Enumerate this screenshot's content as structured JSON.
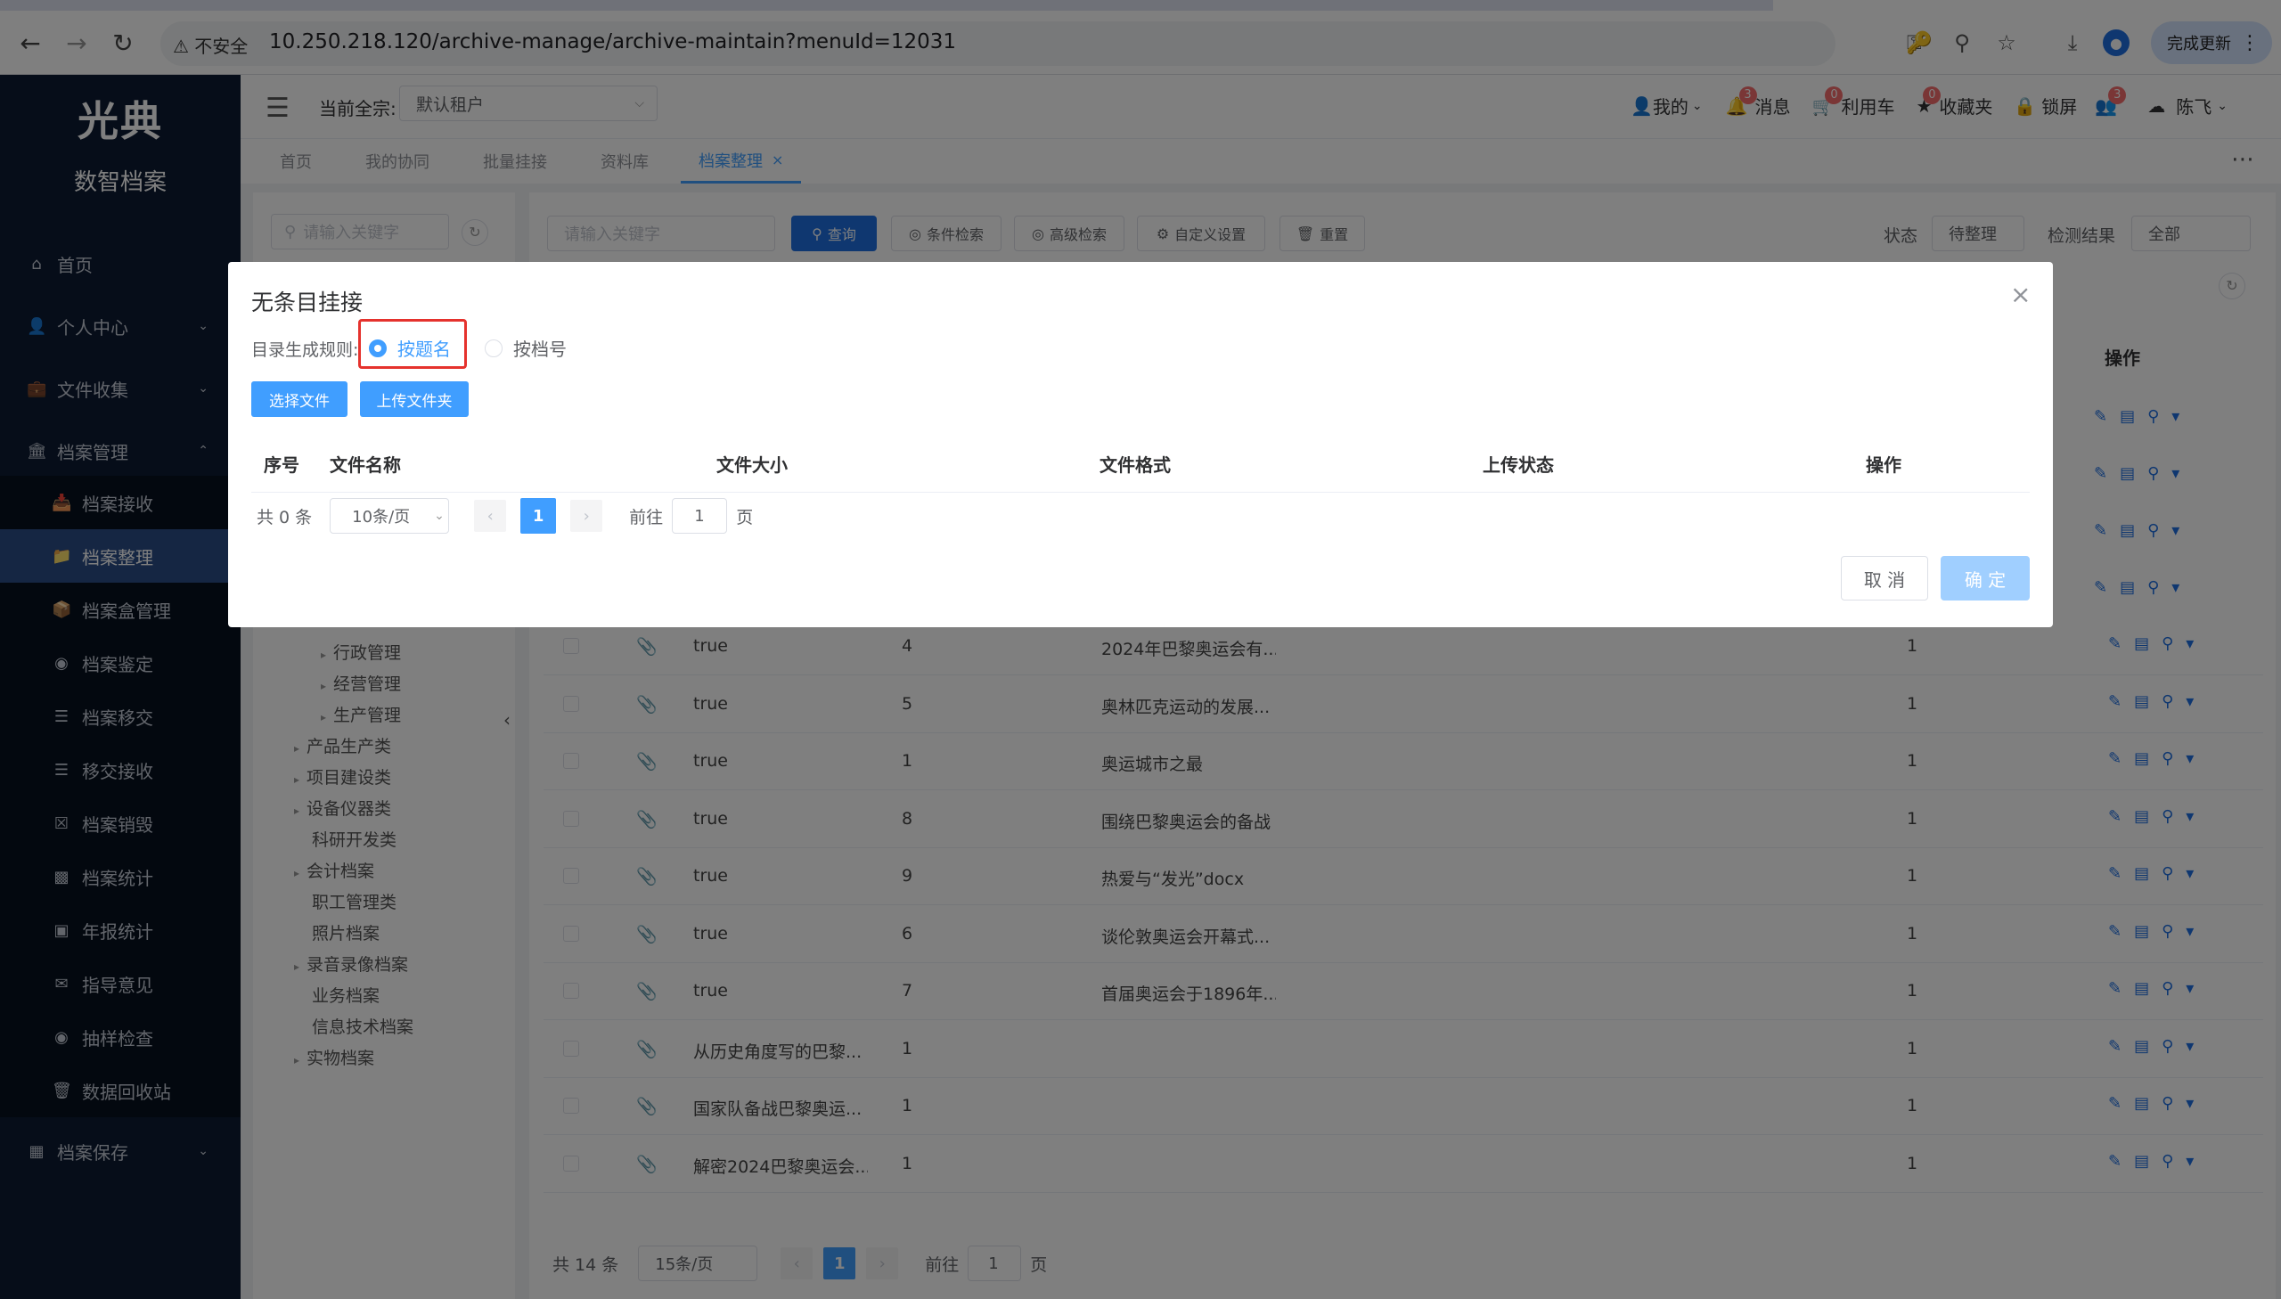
{
  "browser": {
    "insecure_label": "不安全",
    "url": "10.250.218.120/archive-manage/archive-maintain?menuId=12031",
    "update_label": "完成更新"
  },
  "sidebar": {
    "logo_text": "光典",
    "logo_sub": "数智档案",
    "items": [
      {
        "label": "首页",
        "icon": "home-icon"
      },
      {
        "label": "个人中心",
        "icon": "user-icon"
      },
      {
        "label": "文件收集",
        "icon": "briefcase-icon"
      },
      {
        "label": "档案管理",
        "icon": "institution-icon"
      },
      {
        "label": "档案接收",
        "icon": "receive-icon"
      },
      {
        "label": "档案整理",
        "icon": "folder-icon"
      },
      {
        "label": "档案盒管理",
        "icon": "box-icon"
      },
      {
        "label": "档案鉴定",
        "icon": "appraise-icon"
      },
      {
        "label": "档案移交",
        "icon": "list-icon"
      },
      {
        "label": "移交接收",
        "icon": "list-icon"
      },
      {
        "label": "档案销毁",
        "icon": "destroy-icon"
      },
      {
        "label": "档案统计",
        "icon": "bar-chart-icon"
      },
      {
        "label": "年报统计",
        "icon": "report-icon"
      },
      {
        "label": "指导意见",
        "icon": "comment-icon"
      },
      {
        "label": "抽样检查",
        "icon": "sample-icon"
      },
      {
        "label": "数据回收站",
        "icon": "trash-icon"
      },
      {
        "label": "档案保存",
        "icon": "archive-icon"
      }
    ]
  },
  "header": {
    "tenant_label": "当前全宗:",
    "tenant_value": "默认租户",
    "mine": "我的",
    "messages": "消息",
    "messages_badge": "3",
    "cart": "利用车",
    "cart_badge": "0",
    "favorites": "收藏夹",
    "favorites_badge": "0",
    "lock": "锁屏",
    "user_badge": "3",
    "username": "陈飞"
  },
  "tabs": [
    "首页",
    "我的协同",
    "批量挂接",
    "资料库",
    "档案整理"
  ],
  "toolbar": {
    "left_search_placeholder": "请输入关键字",
    "search_placeholder": "请输入关键字",
    "query": "查询",
    "condition_search": "条件检索",
    "advanced_search": "高级检索",
    "custom_settings": "自定义设置",
    "reset": "重置",
    "status_label": "状态",
    "status_value": "待整理",
    "check_label": "检测结果",
    "check_value": "全部",
    "ops_header": "操作"
  },
  "tree": [
    "行政管理",
    "经营管理",
    "生产管理",
    "产品生产类",
    "项目建设类",
    "设备仪器类",
    "科研开发类",
    "会计档案",
    "职工管理类",
    "照片档案",
    "录音录像档案",
    "业务档案",
    "信息技术档案",
    "实物档案"
  ],
  "rows": [
    {
      "c1": "true",
      "c2": "4",
      "c3": "2024年巴黎奥运会有...",
      "c4": "1"
    },
    {
      "c1": "true",
      "c2": "5",
      "c3": "奥林匹克运动的发展...",
      "c4": "1"
    },
    {
      "c1": "true",
      "c2": "1",
      "c3": "奥运城市之最",
      "c4": "1"
    },
    {
      "c1": "true",
      "c2": "8",
      "c3": "围绕巴黎奥运会的备战",
      "c4": "1"
    },
    {
      "c1": "true",
      "c2": "9",
      "c3": "热爱与“发光”docx",
      "c4": "1"
    },
    {
      "c1": "true",
      "c2": "6",
      "c3": "谈伦敦奥运会开幕式...",
      "c4": "1"
    },
    {
      "c1": "true",
      "c2": "7",
      "c3": "首届奥运会于1896年...",
      "c4": "1"
    },
    {
      "c1": "从历史角度写的巴黎...",
      "c2": "1",
      "c3": "",
      "c4": "1"
    },
    {
      "c1": "国家队备战巴黎奥运...",
      "c2": "1",
      "c3": "",
      "c4": "1"
    },
    {
      "c1": "解密2024巴黎奥运会...",
      "c2": "1",
      "c3": "",
      "c4": "1"
    }
  ],
  "pager": {
    "total": "共 14 条",
    "size": "15条/页",
    "current": "1",
    "goto": "前往",
    "goto_value": "1",
    "page_unit": "页"
  },
  "dialog": {
    "title": "无条目挂接",
    "rule_label": "目录生成规则:",
    "option_by_title": "按题名",
    "option_by_number": "按档号",
    "select_file": "选择文件",
    "upload_folder": "上传文件夹",
    "columns": [
      "序号",
      "文件名称",
      "文件大小",
      "文件格式",
      "上传状态",
      "操作"
    ],
    "total": "共 0 条",
    "page_size": "10条/页",
    "current_page": "1",
    "goto": "前往",
    "goto_value": "1",
    "page_unit": "页",
    "cancel": "取 消",
    "confirm": "确 定"
  },
  "colors": {
    "primary": "#409eff",
    "sidebar_bg": "#0d1b33",
    "highlight": "#e5322d"
  }
}
